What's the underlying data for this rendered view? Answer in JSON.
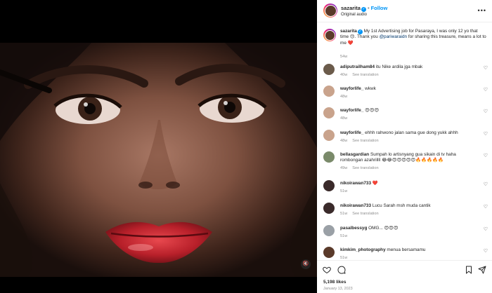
{
  "post": {
    "username": "sazarita",
    "follow_label": "Follow",
    "audio": "Original audio",
    "caption": {
      "username": "sazarita",
      "text_before": "My 1st Advertising job for Pasaraya, I was only 12 yo that time 🙃. Thank you ",
      "mention": "@pariwaraidn",
      "text_after": " for sharing this treasure, means a lot to me ❤️",
      "time": "54w"
    },
    "likes": "5,198 likes",
    "date": "January 13, 2023"
  },
  "comments": [
    {
      "user": "adiputrailham84",
      "text": "itu Nike ardila jga mbak",
      "time": "40w",
      "translation": "See translation",
      "avatar_color": "#6b5b4b"
    },
    {
      "user": "wayforlife_",
      "text": "wkwk",
      "time": "48w",
      "translation": "",
      "avatar_color": "#c9a38c"
    },
    {
      "user": "wayforlife_",
      "text": "😍😍😍",
      "time": "48w",
      "translation": "",
      "avatar_color": "#c9a38c"
    },
    {
      "user": "wayforlife_",
      "text": "ehhh rahwono jalan sama gue dong yukk ahhh",
      "time": "48w",
      "translation": "See translation",
      "avatar_color": "#c9a38c"
    },
    {
      "user": "bellasgardian",
      "text": "Sumpah lo artisnyang gua sikain di tv haha rombongan azahrillll 😂😂😍😍😍😍😍🔥🔥🔥🔥🔥",
      "time": "49w",
      "translation": "See translation",
      "avatar_color": "#7a8a6a"
    },
    {
      "user": "nikoirawan733",
      "text": "❤️",
      "time": "51w",
      "translation": "",
      "avatar_color": "#3a2a2a"
    },
    {
      "user": "nikoirawan733",
      "text": "Lucu Sarah msh muda cantik",
      "time": "51w",
      "translation": "See translation",
      "avatar_color": "#3a2a2a"
    },
    {
      "user": "pasalbessyg",
      "text": "OMG... 😍😍😍",
      "time": "51w",
      "translation": "",
      "avatar_color": "#9aa0a6"
    },
    {
      "user": "kimkim_photography",
      "text": "menua bersamamu",
      "time": "51w",
      "translation": "",
      "avatar_color": "#5a3a2a"
    }
  ],
  "icons": {
    "more": "more-icon",
    "heart": "heart-icon",
    "comment": "comment-icon",
    "save": "bookmark-icon",
    "share": "share-icon",
    "mute": "mute-icon"
  },
  "colors": {
    "accent": "#0095f6",
    "text": "#262626",
    "muted": "#8e8e8e"
  }
}
